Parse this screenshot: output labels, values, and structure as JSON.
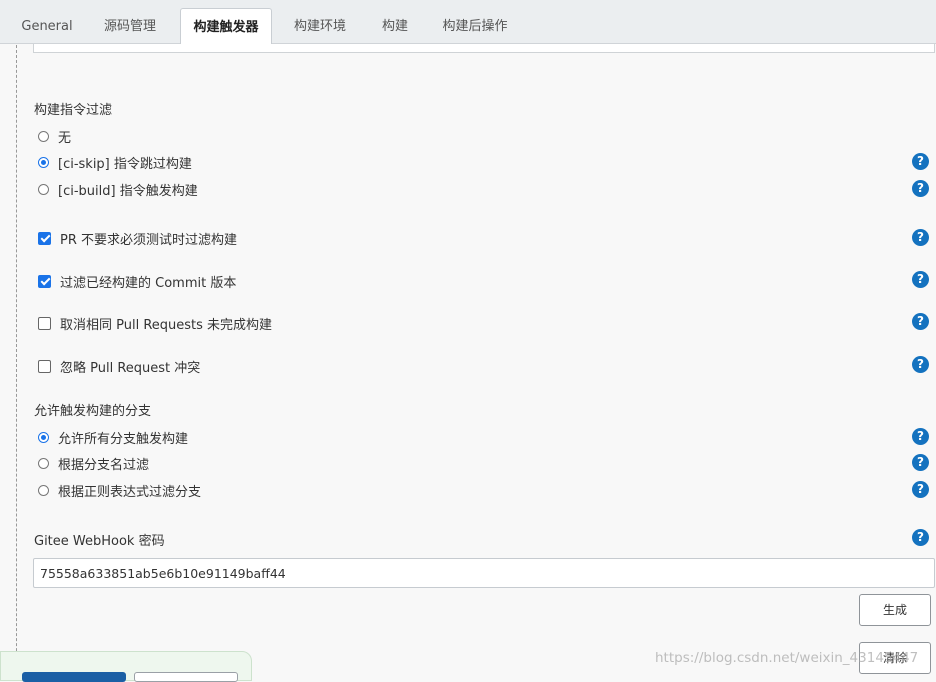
{
  "tabs": [
    {
      "label": "General"
    },
    {
      "label": "源码管理"
    },
    {
      "label": "构建触发器"
    },
    {
      "label": "构建环境"
    },
    {
      "label": "构建"
    },
    {
      "label": "构建后操作"
    }
  ],
  "active_tab": "构建触发器",
  "instruction_filter": {
    "label": "构建指令过滤",
    "options": [
      {
        "label": "无",
        "selected": false
      },
      {
        "label": "[ci-skip] 指令跳过构建",
        "selected": true
      },
      {
        "label": "[ci-build] 指令触发构建",
        "selected": false
      }
    ]
  },
  "checkboxes": [
    {
      "label": "PR 不要求必须测试时过滤构建",
      "checked": true
    },
    {
      "label": "过滤已经构建的 Commit 版本",
      "checked": true
    },
    {
      "label": "取消相同 Pull Requests 未完成构建",
      "checked": false
    },
    {
      "label": "忽略 Pull Request 冲突",
      "checked": false
    }
  ],
  "branch_filter": {
    "label": "允许触发构建的分支",
    "options": [
      {
        "label": "允许所有分支触发构建",
        "selected": true
      },
      {
        "label": "根据分支名过滤",
        "selected": false
      },
      {
        "label": "根据正则表达式过滤分支",
        "selected": false
      }
    ]
  },
  "webhook": {
    "label": "Gitee WebHook 密码",
    "value": "75558a633851ab5e6b10e91149baff44"
  },
  "buttons": {
    "generate": "生成",
    "clear": "清除"
  },
  "help_glyph": "?",
  "watermark": "https://blog.csdn.net/weixin_43145447",
  "colors": {
    "accent": "#1a73e8",
    "help_icon": "#1472bf",
    "tab_bar": "#ebeef0",
    "page_bg": "#f8f8f8"
  }
}
